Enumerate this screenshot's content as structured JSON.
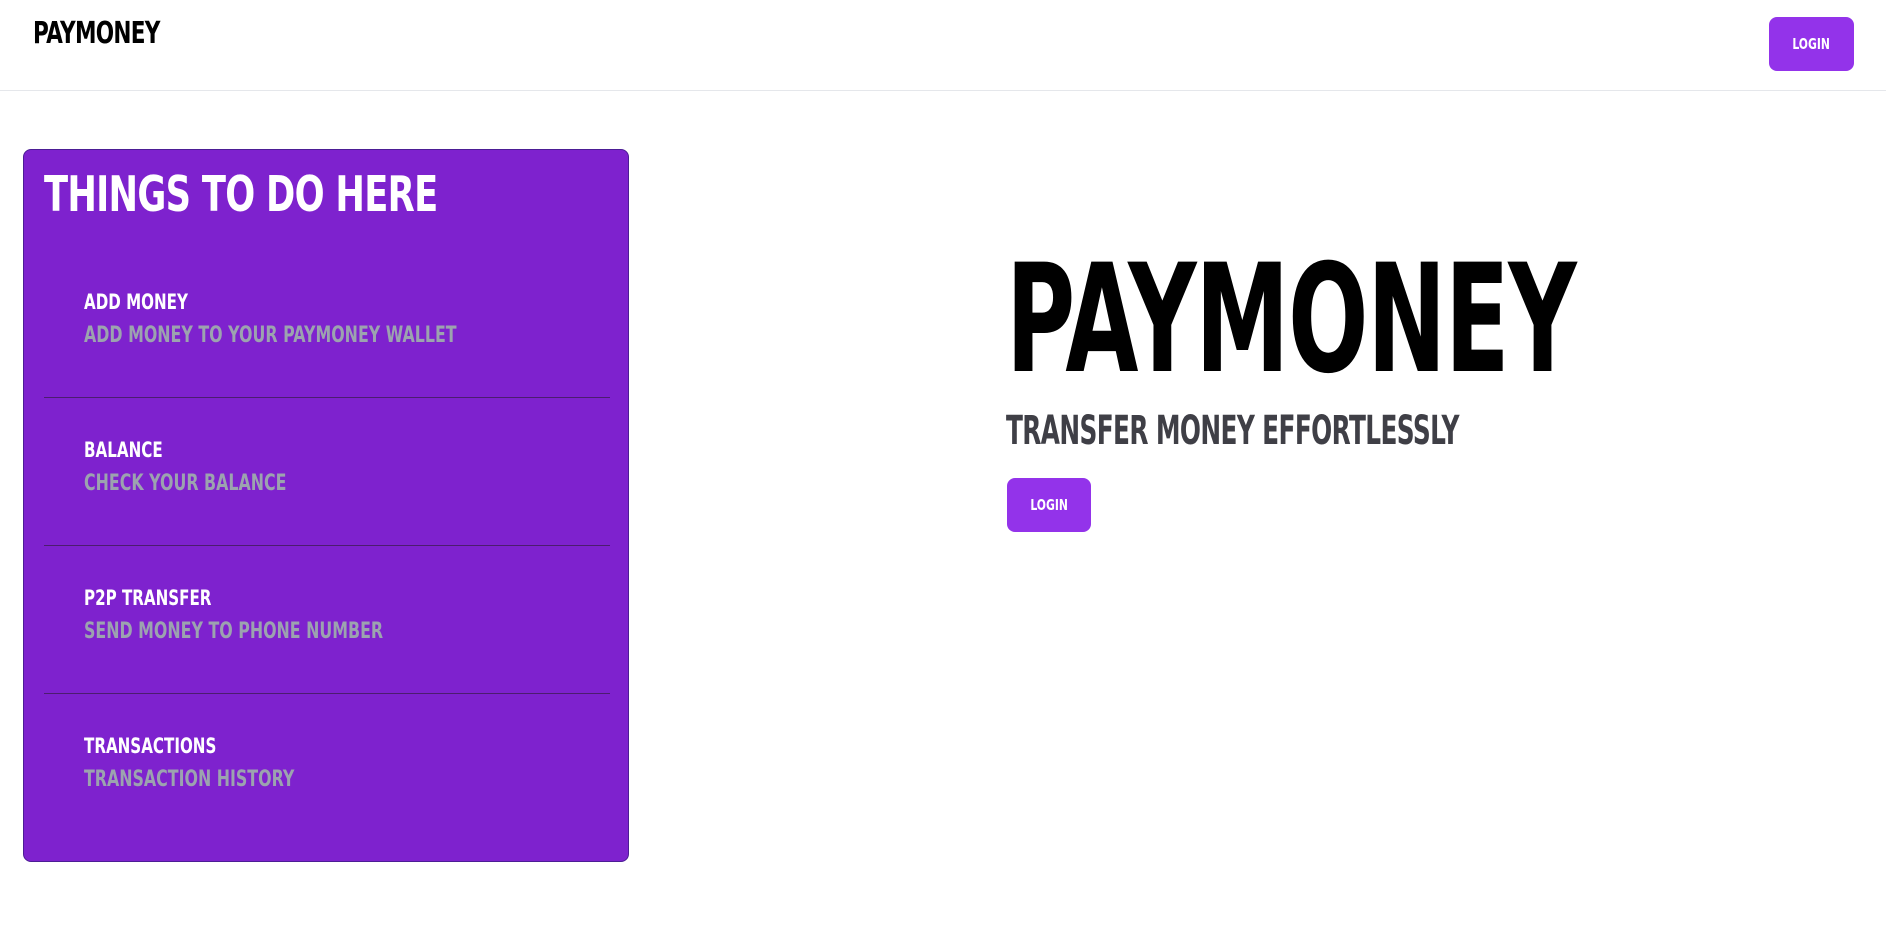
{
  "navbar": {
    "brand": "PAYMONEY",
    "login_label": "LOGIN"
  },
  "features": {
    "title": "THINGS TO DO HERE",
    "items": [
      {
        "title": "ADD MONEY",
        "description": "ADD MONEY TO YOUR PAYMONEY WALLET"
      },
      {
        "title": "BALANCE",
        "description": "CHECK YOUR BALANCE"
      },
      {
        "title": "P2P TRANSFER",
        "description": "SEND MONEY TO PHONE NUMBER"
      },
      {
        "title": "TRANSACTIONS",
        "description": "TRANSACTION HISTORY"
      }
    ]
  },
  "hero": {
    "title": "PAYMONEY",
    "subtitle": "TRANSFER MONEY EFFORTLESSLY",
    "login_label": "LOGIN"
  },
  "colors": {
    "accent": "#9333ea",
    "panel": "#7e22ce",
    "muted_text": "#9ca3af"
  }
}
